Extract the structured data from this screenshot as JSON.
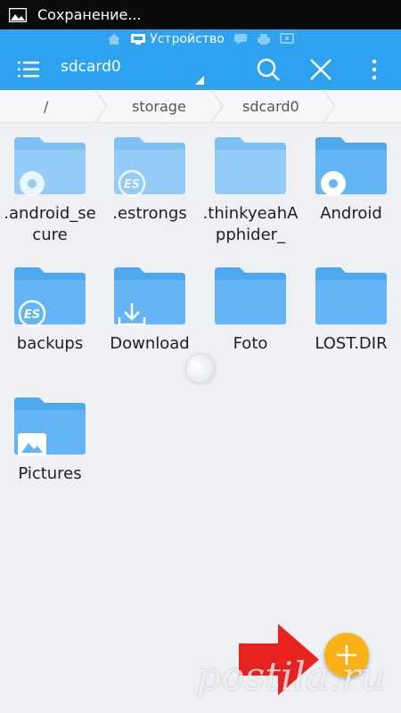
{
  "status_bar": {
    "notification": "Сохранение...",
    "icon": "image-icon"
  },
  "tab_strip": {
    "active_tab_label": "Устройство",
    "icons": [
      "home-icon",
      "device-icon",
      "chat-icon",
      "printer-icon",
      "cast-icon"
    ]
  },
  "toolbar": {
    "location": "sdcard0",
    "menu_icon": "menu-icon",
    "search_icon": "search-icon",
    "close_icon": "close-icon",
    "more_icon": "more-vert-icon"
  },
  "breadcrumb": [
    "/",
    "storage",
    "sdcard0"
  ],
  "folders": [
    {
      "name": ".android_secure",
      "badge": "gear-icon"
    },
    {
      "name": ".estrongs",
      "badge": "es-logo-icon"
    },
    {
      "name": ".thinkyeahApphider_",
      "badge": ""
    },
    {
      "name": "Android",
      "badge": "gear-icon"
    },
    {
      "name": "backups",
      "badge": "es-logo-icon"
    },
    {
      "name": "Download",
      "badge": "download-icon"
    },
    {
      "name": "Foto",
      "badge": ""
    },
    {
      "name": "LOST.DIR",
      "badge": ""
    },
    {
      "name": "Pictures",
      "badge": "picture-icon"
    }
  ],
  "fab": {
    "icon": "plus-icon"
  },
  "watermark": "postila.ru",
  "colors": {
    "appbar": "#2ea1ef",
    "folder": "#64b5f6",
    "fab": "#fbb118",
    "arrow": "#e8231f"
  }
}
